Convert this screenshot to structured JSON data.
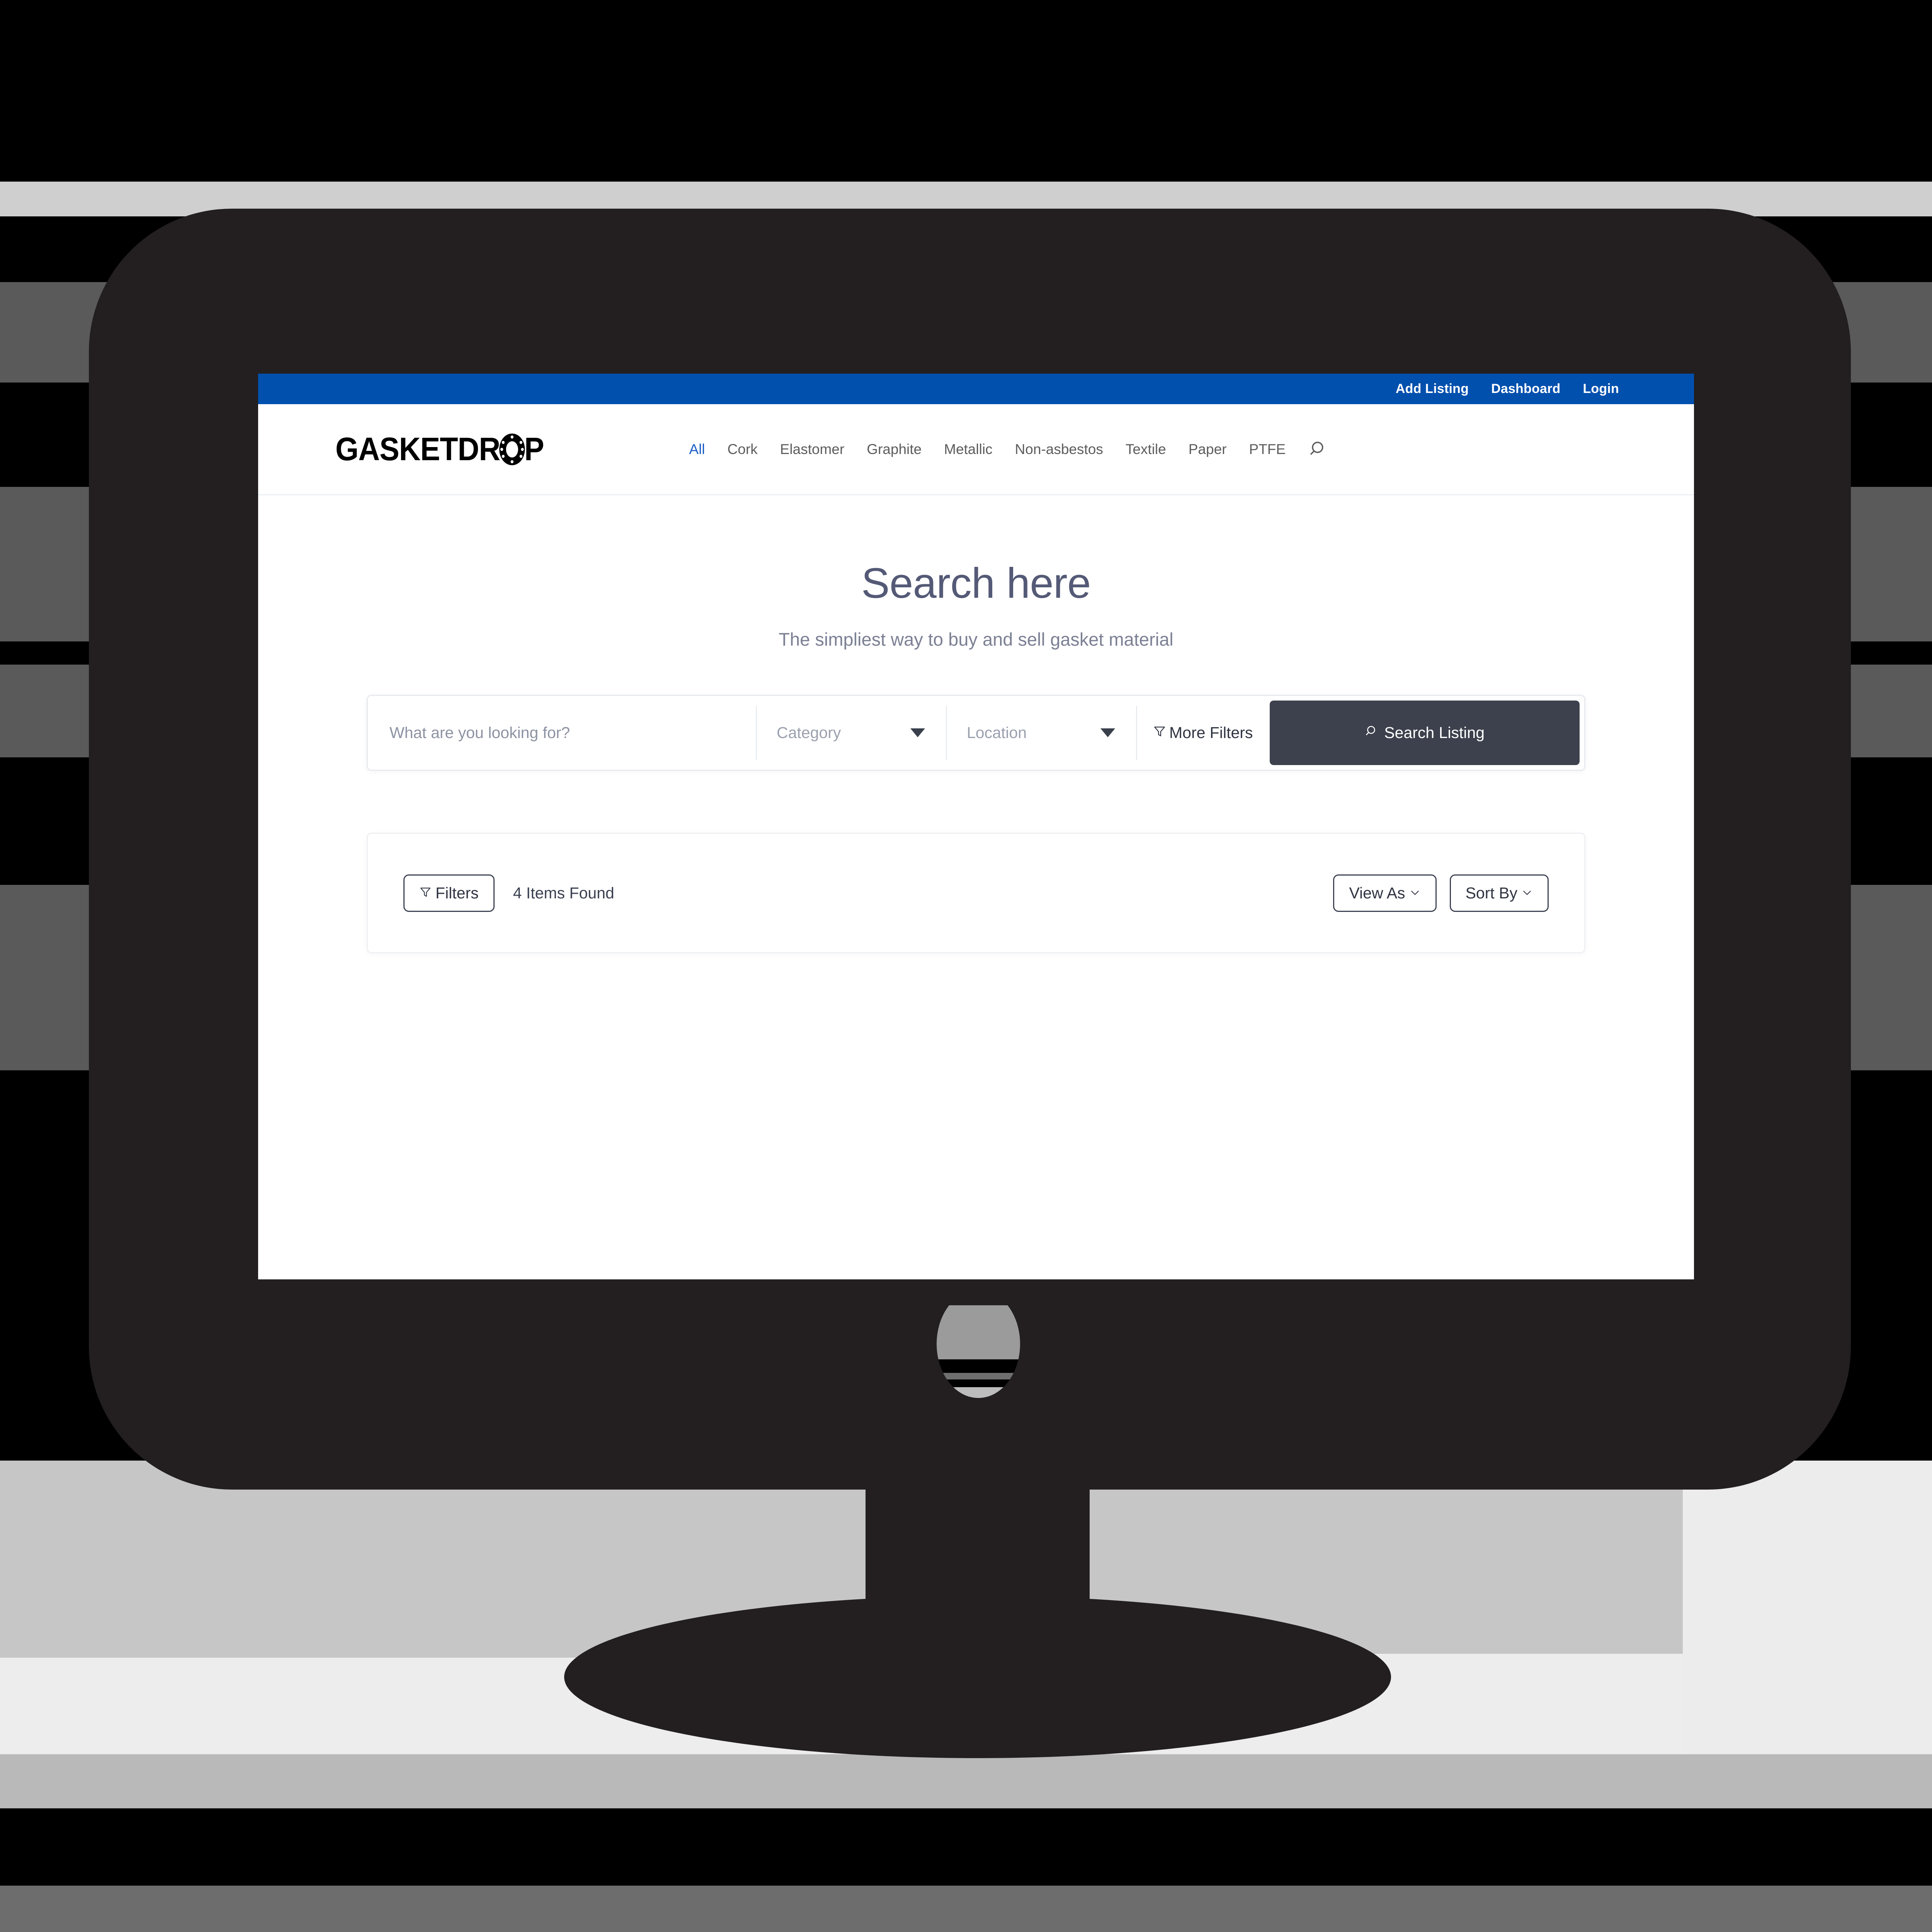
{
  "colors": {
    "topbar_blue": "#0250ae",
    "nav_active": "#1a5fc4",
    "hero_heading": "#545a76",
    "hero_sub": "#7b8094",
    "search_button_bg": "#3d414d",
    "bezel": "#231f20"
  },
  "topbar": {
    "links": [
      {
        "label": "Add Listing",
        "name": "add-listing-link"
      },
      {
        "label": "Dashboard",
        "name": "dashboard-link"
      },
      {
        "label": "Login",
        "name": "login-link"
      }
    ]
  },
  "header": {
    "logo_text": "GASKETDROP",
    "logo_icon": "gasket-flange-icon",
    "nav": [
      {
        "label": "All",
        "active": true
      },
      {
        "label": "Cork",
        "active": false
      },
      {
        "label": "Elastomer",
        "active": false
      },
      {
        "label": "Graphite",
        "active": false
      },
      {
        "label": "Metallic",
        "active": false
      },
      {
        "label": "Non-asbestos",
        "active": false
      },
      {
        "label": "Textile",
        "active": false
      },
      {
        "label": "Paper",
        "active": false
      },
      {
        "label": "PTFE",
        "active": false
      }
    ],
    "search_icon": "search-icon"
  },
  "hero": {
    "title": "Search here",
    "subtitle": "The simpliest way to buy and sell gasket material"
  },
  "search": {
    "keyword_placeholder": "What are you looking for?",
    "keyword_value": "",
    "category_label": "Category",
    "location_label": "Location",
    "more_filters_label": "More Filters",
    "more_filters_icon": "funnel-icon",
    "search_button_label": "Search Listing",
    "search_button_icon": "search-icon"
  },
  "results": {
    "filters_label": "Filters",
    "filters_icon": "funnel-icon",
    "items_found": "4 Items Found",
    "view_as_label": "View As",
    "sort_by_label": "Sort By",
    "chevron_icon": "chevron-down-icon"
  }
}
